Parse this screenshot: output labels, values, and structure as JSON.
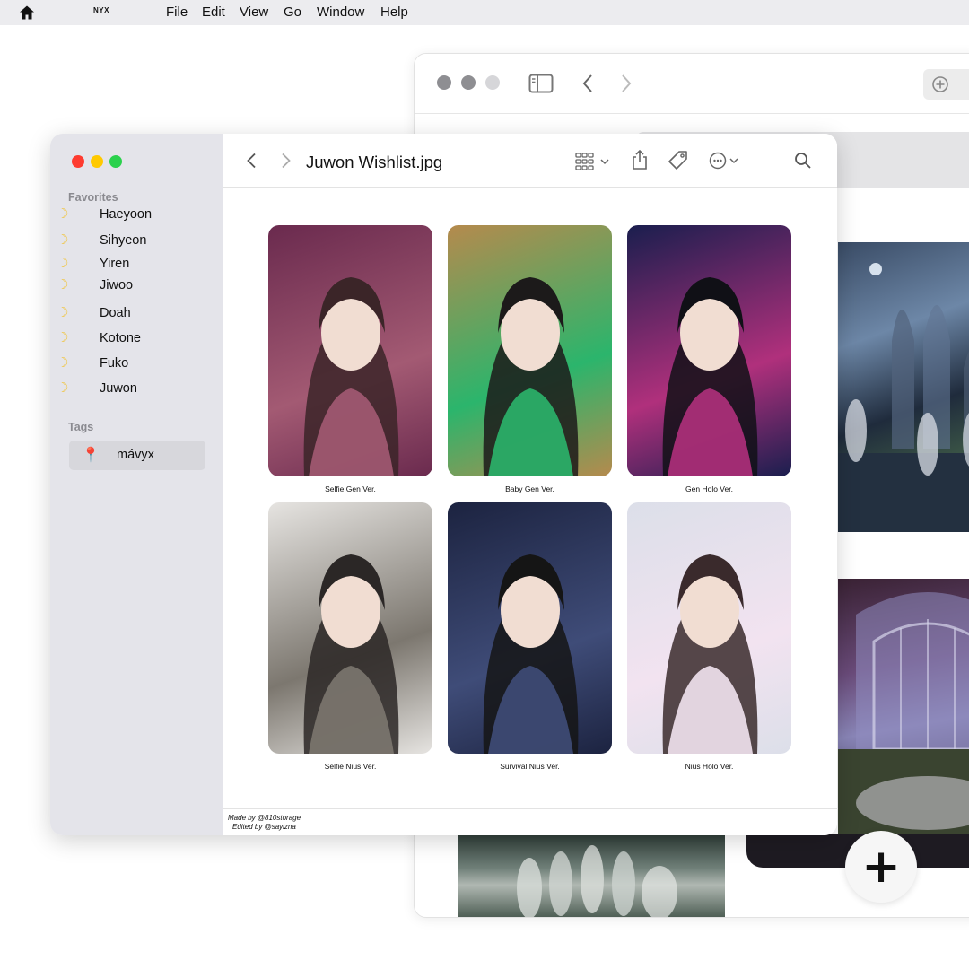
{
  "menubar": {
    "icon": "home-icon",
    "app_name": "NYX",
    "menus": [
      "File",
      "Edit",
      "View",
      "Go",
      "Window",
      "Help"
    ]
  },
  "back_window": {
    "add_icon": "circle-plus-icon",
    "fab_label": "+"
  },
  "finder": {
    "title": "Juwon Wishlist.jpg",
    "sidebar": {
      "favorites_heading": "Favorites",
      "favorites": [
        "Haeyoon",
        "Sihyeon",
        "Yiren",
        "Jiwoo",
        "Doah",
        "Kotone",
        "Fuko",
        "Juwon"
      ],
      "favorite_icon": "crescent-moon-icon",
      "tags_heading": "Tags",
      "tag": {
        "icon": "pin-icon",
        "label": "mávyx"
      }
    },
    "grid": [
      {
        "caption": "Selfie Gen Ver.",
        "colors": [
          "#6a2a4e",
          "#a35a73",
          "#3b2528"
        ]
      },
      {
        "caption": "Baby Gen Ver.",
        "colors": [
          "#b58a4d",
          "#2bb56c",
          "#1c1a1a"
        ]
      },
      {
        "caption": "Gen Holo Ver.",
        "colors": [
          "#1a1e4e",
          "#b0307c",
          "#101016"
        ]
      },
      {
        "caption": "Selfie Nius Ver.",
        "colors": [
          "#e6e4e1",
          "#7c776f",
          "#2b2726"
        ]
      },
      {
        "caption": "Survival Nius Ver.",
        "colors": [
          "#1c2340",
          "#3f4c78",
          "#151515"
        ]
      },
      {
        "caption": "Nius Holo Ver.",
        "colors": [
          "#dcdfe9",
          "#f2e3f0",
          "#3a2a2c"
        ]
      }
    ],
    "footer": {
      "made_by": "Made by @810storage",
      "edited_by": "Edited by @sayizna"
    }
  },
  "colors": {
    "close": "#fe5f57",
    "minimize": "#febc2e",
    "zoom": "#28c840",
    "sidebar_bg": "#e4e4ea"
  }
}
